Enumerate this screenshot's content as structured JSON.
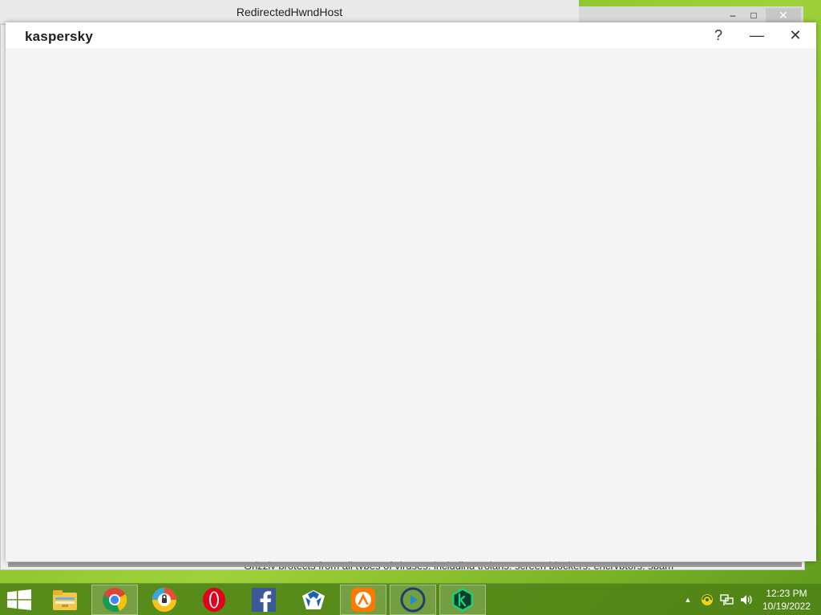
{
  "background_window": {
    "title": "RedirectedHwndHost",
    "controls": {
      "minimize": "‒",
      "maximize": "□",
      "close": "✕"
    },
    "partial_text": "Grizzly protects from all types of viruses, including trojans, screen blockers, encryptors, spam"
  },
  "kaspersky_window": {
    "logo": "kaspersky",
    "help_label": "?",
    "minimize_label": "—",
    "close_label": "✕"
  },
  "taskbar": {
    "apps": [
      {
        "name": "File Explorer",
        "icon": "file-explorer-icon"
      },
      {
        "name": "Google Chrome",
        "icon": "chrome-icon"
      },
      {
        "name": "Browser",
        "icon": "browser-icon"
      },
      {
        "name": "Opera",
        "icon": "opera-icon"
      },
      {
        "name": "Facebook",
        "icon": "facebook-icon"
      },
      {
        "name": "Malwarebytes",
        "icon": "malwarebytes-icon"
      },
      {
        "name": "Avast",
        "icon": "avast-icon"
      },
      {
        "name": "Media Player",
        "icon": "media-player-icon"
      },
      {
        "name": "Kaspersky",
        "icon": "kaspersky-icon"
      }
    ],
    "time": "12:23 PM",
    "date": "10/19/2022"
  },
  "colors": {
    "desktop": "#86c02c",
    "taskbar": "#4e8216",
    "kaspersky_green": "#00a88e"
  }
}
